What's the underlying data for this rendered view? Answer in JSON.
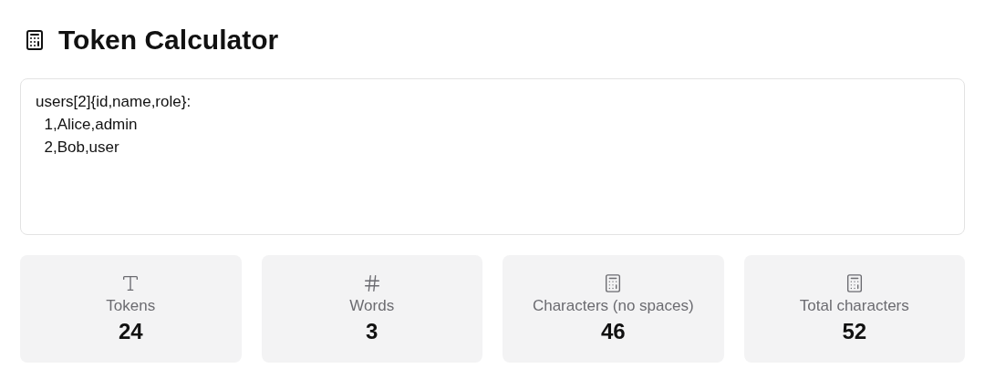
{
  "title": "Token Calculator",
  "editor": {
    "value": "users[2]{id,name,role}:\n  1,Alice,admin\n  2,Bob,user"
  },
  "stats": [
    {
      "kind": "text",
      "label": "Tokens",
      "value": "24"
    },
    {
      "kind": "hash",
      "label": "Words",
      "value": "3"
    },
    {
      "kind": "calculator",
      "label": "Characters (no spaces)",
      "value": "46"
    },
    {
      "kind": "calculator",
      "label": "Total characters",
      "value": "52"
    }
  ]
}
